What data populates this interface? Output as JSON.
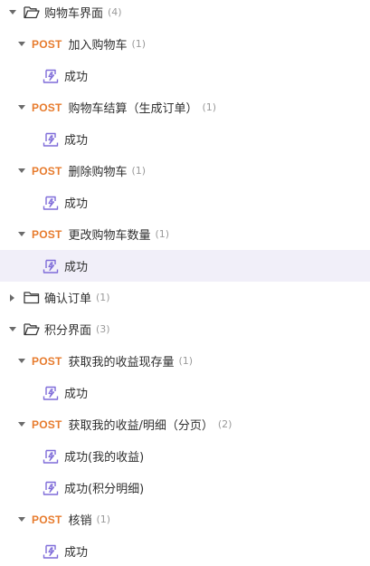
{
  "tree": [
    {
      "kind": "folder",
      "expanded": true,
      "label": "购物车界面",
      "count": "(4)",
      "children": [
        {
          "method": "POST",
          "label": "加入购物车",
          "count": "(1)",
          "cases": [
            "成功"
          ]
        },
        {
          "method": "POST",
          "label": "购物车结算（生成订单）",
          "count": "(1)",
          "cases": [
            "成功"
          ]
        },
        {
          "method": "POST",
          "label": "删除购物车",
          "count": "(1)",
          "cases": [
            "成功"
          ]
        },
        {
          "method": "POST",
          "label": "更改购物车数量",
          "count": "(1)",
          "cases": [
            "成功"
          ],
          "selected_case": 0
        }
      ]
    },
    {
      "kind": "folder",
      "expanded": false,
      "label": "确认订单",
      "count": "(1)",
      "children": []
    },
    {
      "kind": "folder",
      "expanded": true,
      "label": "积分界面",
      "count": "(3)",
      "children": [
        {
          "method": "POST",
          "label": "获取我的收益现存量",
          "count": "(1)",
          "cases": [
            "成功"
          ]
        },
        {
          "method": "POST",
          "label": "获取我的收益/明细（分页）",
          "count": "(2)",
          "cases": [
            "成功(我的收益)",
            "成功(积分明细)"
          ]
        },
        {
          "method": "POST",
          "label": "核销",
          "count": "(1)",
          "cases": [
            "成功"
          ]
        }
      ]
    }
  ],
  "colors": {
    "method_post": "#e77b2d",
    "case_icon": "#7f6cd9",
    "selected_bg": "#f1eff9"
  },
  "icons": {
    "folder_open": "folder-open-icon",
    "folder_closed": "folder-icon",
    "case": "test-case-icon",
    "expanded": "caret-down-icon",
    "collapsed": "caret-right-icon"
  }
}
